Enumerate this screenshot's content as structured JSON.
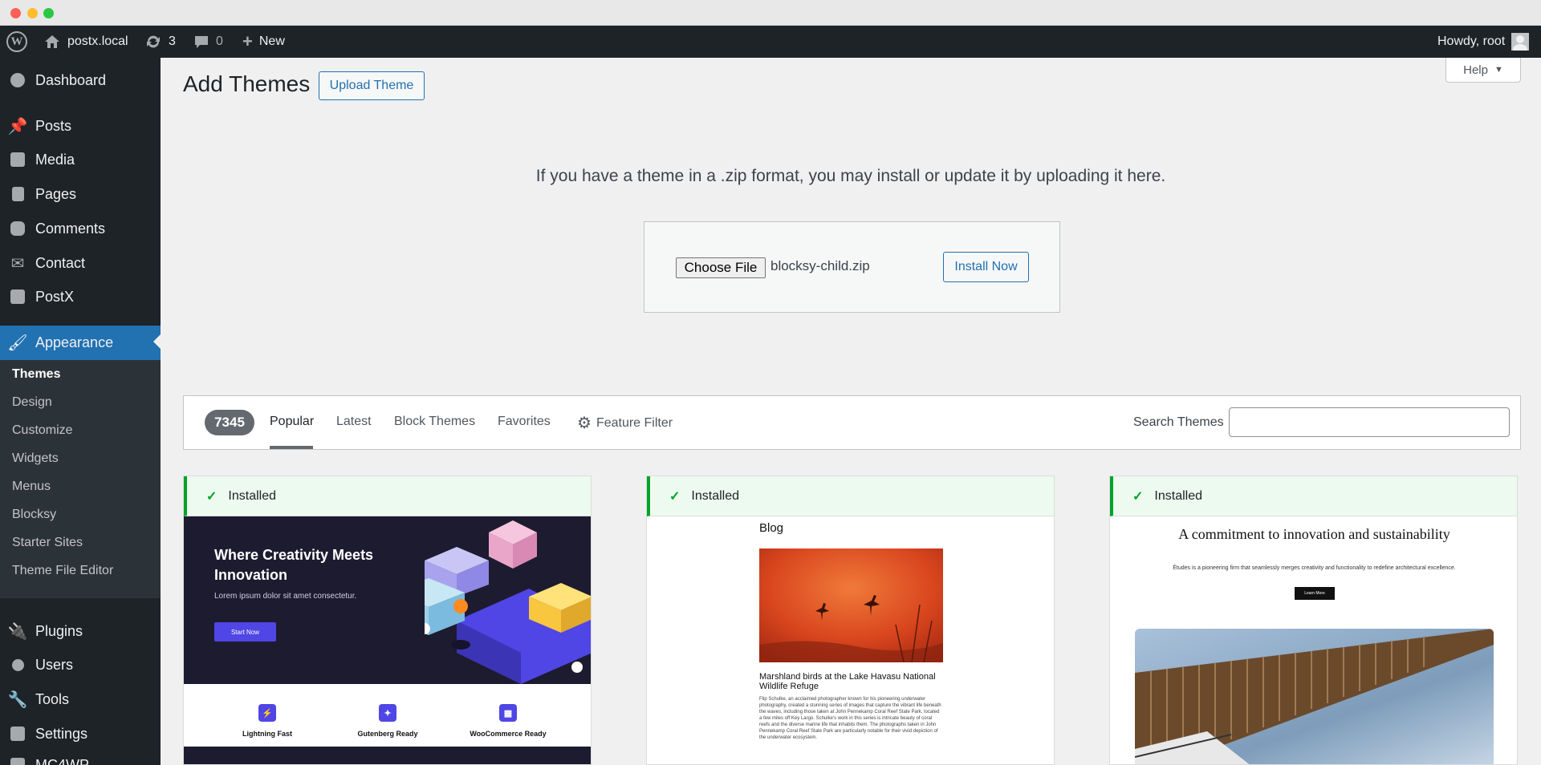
{
  "adminbar": {
    "site_name": "postx.local",
    "updates_count": "3",
    "comments_count": "0",
    "new_label": "New",
    "greeting": "Howdy, root"
  },
  "sidebar": {
    "items": [
      {
        "label": "Dashboard",
        "icon": "dashboard-icon"
      },
      {
        "label": "Posts",
        "icon": "pin-icon"
      },
      {
        "label": "Media",
        "icon": "media-icon"
      },
      {
        "label": "Pages",
        "icon": "pages-icon"
      },
      {
        "label": "Comments",
        "icon": "comment-icon"
      },
      {
        "label": "Contact",
        "icon": "mail-icon"
      },
      {
        "label": "PostX",
        "icon": "postx-icon"
      },
      {
        "label": "Appearance",
        "icon": "brush-icon"
      },
      {
        "label": "Plugins",
        "icon": "plugin-icon"
      },
      {
        "label": "Users",
        "icon": "user-icon"
      },
      {
        "label": "Tools",
        "icon": "wrench-icon"
      },
      {
        "label": "Settings",
        "icon": "settings-icon"
      },
      {
        "label": "MC4WP",
        "icon": "mc4wp-icon"
      }
    ],
    "submenu": [
      "Themes",
      "Design",
      "Customize",
      "Widgets",
      "Menus",
      "Blocksy",
      "Starter Sites",
      "Theme File Editor"
    ]
  },
  "main": {
    "title": "Add Themes",
    "upload_button": "Upload Theme",
    "help_label": "Help",
    "upload_text": "If you have a theme in a .zip format, you may install or update it by uploading it here.",
    "choose_file_label": "Choose File",
    "file_name": "blocksy-child.zip",
    "install_button": "Install Now"
  },
  "filter": {
    "count": "7345",
    "tabs": [
      "Popular",
      "Latest",
      "Block Themes",
      "Favorites"
    ],
    "feature_filter": "Feature Filter",
    "search_label": "Search Themes",
    "search_value": ""
  },
  "themes": [
    {
      "status": "Installed",
      "preview": {
        "headline": "Where Creativity Meets Innovation",
        "sub": "Lorem ipsum dolor sit amet consectetur.",
        "cta": "Start Now",
        "features": [
          "Lightning Fast",
          "Gutenberg Ready",
          "WooCommerce Ready"
        ]
      }
    },
    {
      "status": "Installed",
      "preview": {
        "blog_title": "Blog",
        "caption": "Marshland birds at the Lake Havasu National Wildlife Refuge",
        "body": "Flip Schulke, an acclaimed photographer known for his pioneering underwater photography, created a stunning series of images that capture the vibrant life beneath the waves, including those taken at John Pennekamp Coral Reef State Park, located a few miles off Key Largo. Schulke's work in this series is intricate beauty of coral reefs and the diverse marine life that inhabits them. The photographs taken in John Pennekamp Coral Reef State Park are particularly notable for their vivid depiction of the underwater ecosystem."
      }
    },
    {
      "status": "Installed",
      "preview": {
        "headline": "A commitment to innovation and sustainability",
        "sub": "Études is a pioneering firm that seamlessly merges creativity and functionality to redefine architectural excellence.",
        "cta": "Learn More"
      }
    }
  ],
  "colors": {
    "admin_dark": "#1d2327",
    "accent_blue": "#2271b1",
    "installed_green": "#00a32a",
    "page_bg": "#f0f0f1"
  }
}
